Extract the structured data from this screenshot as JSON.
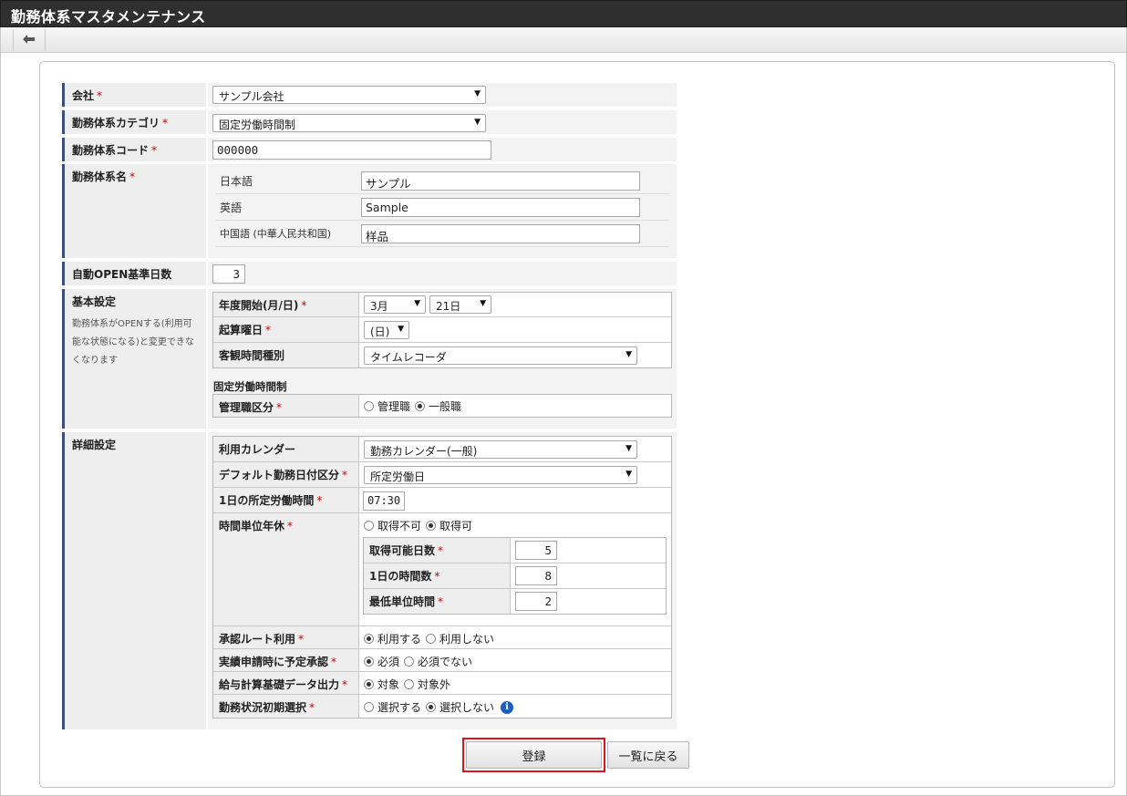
{
  "window": {
    "title": "勤務体系マスタメンテナンス"
  },
  "toolbar": {
    "back_icon": "arrow-left-icon"
  },
  "required_mark": "*",
  "form": {
    "company": {
      "label": "会社",
      "value": "サンプル会社"
    },
    "category": {
      "label": "勤務体系カテゴリ",
      "value": "固定労働時間制"
    },
    "code": {
      "label": "勤務体系コード",
      "value": "000000"
    },
    "name": {
      "label": "勤務体系名",
      "rows": [
        {
          "lang": "日本語",
          "value": "サンプル"
        },
        {
          "lang": "英語",
          "value": "Sample"
        },
        {
          "lang": "中国語 (中華人民共和国)",
          "value": "样品"
        }
      ]
    },
    "auto_open": {
      "label": "自動OPEN基準日数",
      "value": "3"
    },
    "basic": {
      "label": "基本設定",
      "description_lines": [
        "勤務体系がOPENする(利用可",
        "能な状態になる)と変更できな",
        "くなります"
      ],
      "fiscal_start": {
        "label": "年度開始(月/日)",
        "month": "3月",
        "day": "21日"
      },
      "start_weekday": {
        "label": "起算曜日",
        "value": "(日)"
      },
      "objective_time": {
        "label": "客観時間種別",
        "value": "タイムレコーダ"
      },
      "fixed_section": "固定労働時間制",
      "manager_class": {
        "label": "管理職区分",
        "options": [
          "管理職",
          "一般職"
        ],
        "selected": 1
      }
    },
    "detail": {
      "label": "詳細設定",
      "calendar": {
        "label": "利用カレンダー",
        "value": "勤務カレンダー(一般)"
      },
      "default_day": {
        "label": "デフォルト勤務日付区分",
        "value": "所定労働日"
      },
      "daily_hours": {
        "label": "1日の所定労働時間",
        "value": "07:30"
      },
      "hourly_leave": {
        "label": "時間単位年休",
        "options": [
          "取得不可",
          "取得可"
        ],
        "selected": 1,
        "days": {
          "label": "取得可能日数",
          "value": "5"
        },
        "hours": {
          "label": "1日の時間数",
          "value": "8"
        },
        "min_unit": {
          "label": "最低単位時間",
          "value": "2"
        }
      },
      "approval_route": {
        "label": "承認ルート利用",
        "options": [
          "利用する",
          "利用しない"
        ],
        "selected": 0
      },
      "plan_approval": {
        "label": "実績申請時に予定承認",
        "options": [
          "必須",
          "必須でない"
        ],
        "selected": 0
      },
      "payroll_output": {
        "label": "給与計算基礎データ出力",
        "options": [
          "対象",
          "対象外"
        ],
        "selected": 0
      },
      "status_init": {
        "label": "勤務状況初期選択",
        "options": [
          "選択する",
          "選択しない"
        ],
        "selected": 1,
        "info_icon": "info-icon"
      }
    }
  },
  "buttons": {
    "register": "登録",
    "back_to_list": "一覧に戻る"
  },
  "colors": {
    "title_bg": "#2f2f2f",
    "accent_bar": "#3c4c7c",
    "required": "#d40000",
    "highlight": "#e0121a",
    "info": "#1b5fc1"
  }
}
